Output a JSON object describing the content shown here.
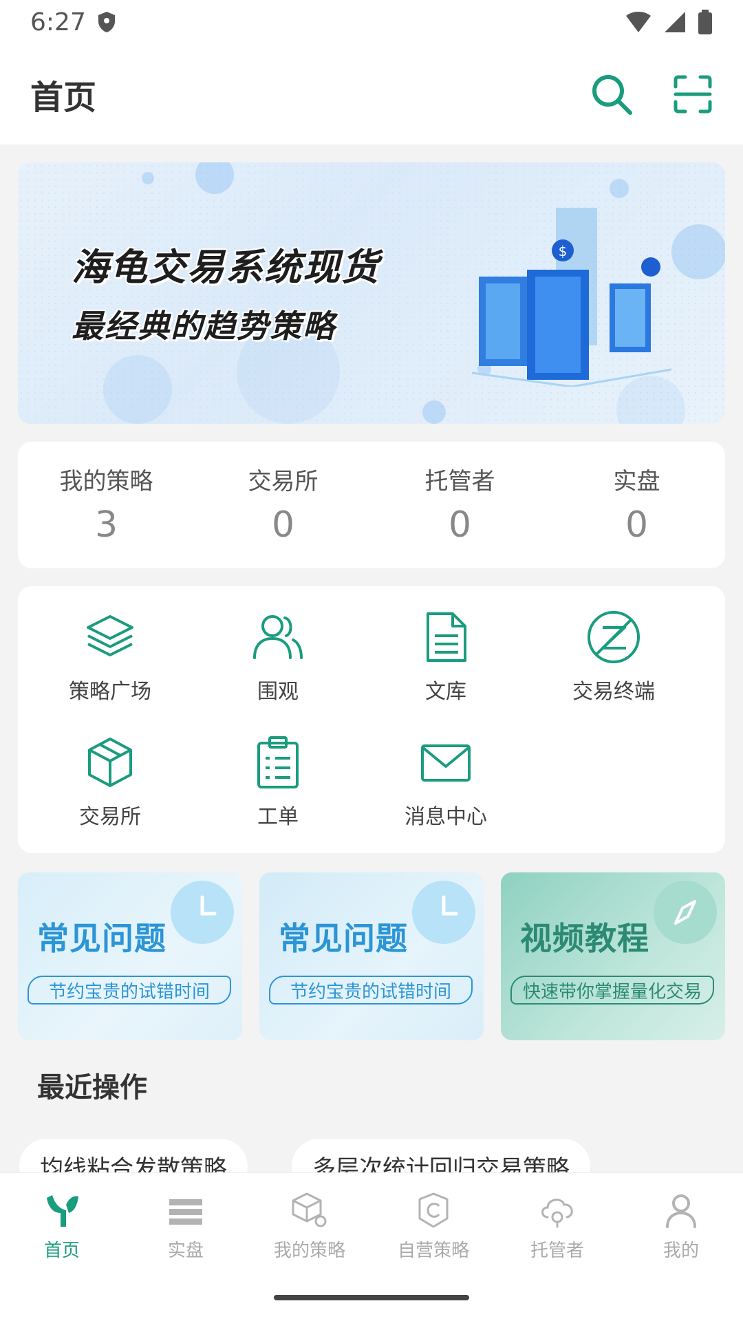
{
  "status_bar": {
    "time": "6:27"
  },
  "header": {
    "title": "首页"
  },
  "banner": {
    "line1": "海龟交易系统现货",
    "line2": "最经典的趋势策略"
  },
  "stats": [
    {
      "label": "我的策略",
      "value": "3"
    },
    {
      "label": "交易所",
      "value": "0"
    },
    {
      "label": "托管者",
      "value": "0"
    },
    {
      "label": "实盘",
      "value": "0"
    }
  ],
  "quick_actions": [
    {
      "label": "策略广场",
      "icon": "layers-icon"
    },
    {
      "label": "围观",
      "icon": "users-icon"
    },
    {
      "label": "文库",
      "icon": "document-icon"
    },
    {
      "label": "交易终端",
      "icon": "terminal-z-icon"
    },
    {
      "label": "交易所",
      "icon": "cube-icon"
    },
    {
      "label": "工单",
      "icon": "clipboard-icon"
    },
    {
      "label": "消息中心",
      "icon": "mail-icon"
    }
  ],
  "promos": [
    {
      "title": "常见问题",
      "subtitle": "节约宝贵的试错时间",
      "icon": "clock-icon"
    },
    {
      "title": "常见问题",
      "subtitle": "节约宝贵的试错时间",
      "icon": "clock-icon"
    },
    {
      "title": "视频教程",
      "subtitle": "快速带你掌握量化交易",
      "icon": "compass-icon"
    }
  ],
  "recent": {
    "title": "最近操作",
    "items": [
      "均线粘合发散策略",
      "多层次统计回归交易策略"
    ]
  },
  "tabs": [
    {
      "label": "首页",
      "icon": "home-logo-icon",
      "active": true
    },
    {
      "label": "实盘",
      "icon": "list-icon"
    },
    {
      "label": "我的策略",
      "icon": "strategy-box-icon"
    },
    {
      "label": "自营策略",
      "icon": "badge-c-icon"
    },
    {
      "label": "托管者",
      "icon": "cloud-icon"
    },
    {
      "label": "我的",
      "icon": "user-icon"
    }
  ],
  "colors": {
    "accent": "#1a9c7e",
    "blue_title": "#2b95d6",
    "teal_title": "#2c8a73"
  }
}
